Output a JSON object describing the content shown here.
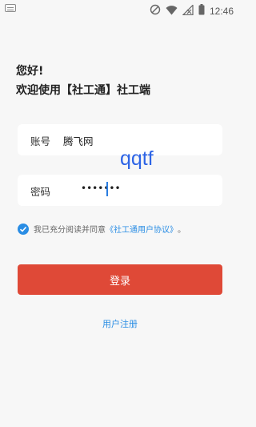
{
  "status_bar": {
    "time": "12:46",
    "icons": [
      "keyboard-icon",
      "signal-off-icon",
      "wifi-icon",
      "cellular-off-icon",
      "battery-icon"
    ]
  },
  "greeting": {
    "line1": "您好!",
    "line2": "欢迎使用【社工通】社工端"
  },
  "form": {
    "account_label": "账号",
    "account_value": "腾飞网",
    "password_label": "密码",
    "password_value": "•••••••"
  },
  "watermark": "qqtf",
  "agreement": {
    "checked": true,
    "text": "我已充分阅读并同意",
    "link": "《社工通用户协议》",
    "suffix": "。"
  },
  "buttons": {
    "login_label": "登录",
    "register_label": "用户注册"
  },
  "colors": {
    "accent": "#2a8de4",
    "button": "#df4937",
    "background": "#f7f7f7"
  }
}
